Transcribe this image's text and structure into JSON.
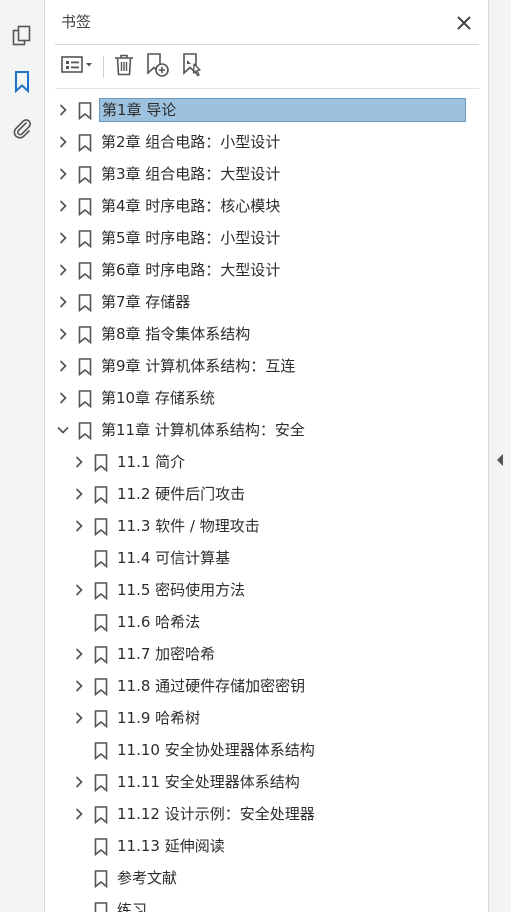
{
  "panel": {
    "title": "书签",
    "close_icon": "close-icon"
  },
  "rail": {
    "items": [
      {
        "name": "page-thumbnails-icon"
      },
      {
        "name": "bookmarks-icon",
        "active": true
      },
      {
        "name": "attachments-icon"
      }
    ]
  },
  "toolbar": {
    "options": "options-menu-icon",
    "delete": "delete-icon",
    "new_bookmark": "new-bookmark-icon",
    "new_from_structure": "new-bookmark-from-structure-icon"
  },
  "colors": {
    "selection_fill": "#9dc2df",
    "selection_border": "#6a9cc4",
    "active_icon": "#1a73c8"
  },
  "bookmarks": [
    {
      "label": "第1章 导论",
      "level": 0,
      "expander": "collapsed",
      "selected": true
    },
    {
      "label": "第2章 组合电路：小型设计",
      "level": 0,
      "expander": "collapsed"
    },
    {
      "label": "第3章 组合电路：大型设计",
      "level": 0,
      "expander": "collapsed"
    },
    {
      "label": "第4章 时序电路：核心模块",
      "level": 0,
      "expander": "collapsed"
    },
    {
      "label": "第5章 时序电路：小型设计",
      "level": 0,
      "expander": "collapsed"
    },
    {
      "label": "第6章 时序电路：大型设计",
      "level": 0,
      "expander": "collapsed"
    },
    {
      "label": "第7章 存储器",
      "level": 0,
      "expander": "collapsed"
    },
    {
      "label": "第8章 指令集体系结构",
      "level": 0,
      "expander": "collapsed"
    },
    {
      "label": "第9章 计算机体系结构：互连",
      "level": 0,
      "expander": "collapsed"
    },
    {
      "label": "第10章 存储系统",
      "level": 0,
      "expander": "collapsed"
    },
    {
      "label": "第11章 计算机体系结构：安全",
      "level": 0,
      "expander": "expanded"
    },
    {
      "label": "11.1 简介",
      "level": 1,
      "expander": "collapsed"
    },
    {
      "label": "11.2 硬件后门攻击",
      "level": 1,
      "expander": "collapsed"
    },
    {
      "label": "11.3 软件 / 物理攻击",
      "level": 1,
      "expander": "collapsed"
    },
    {
      "label": "11.4 可信计算基",
      "level": 1,
      "expander": "none"
    },
    {
      "label": "11.5 密码使用方法",
      "level": 1,
      "expander": "collapsed"
    },
    {
      "label": "11.6 哈希法",
      "level": 1,
      "expander": "none"
    },
    {
      "label": "11.7 加密哈希",
      "level": 1,
      "expander": "collapsed"
    },
    {
      "label": "11.8 通过硬件存储加密密钥",
      "level": 1,
      "expander": "collapsed"
    },
    {
      "label": "11.9 哈希树",
      "level": 1,
      "expander": "collapsed"
    },
    {
      "label": "11.10 安全协处理器体系结构",
      "level": 1,
      "expander": "none"
    },
    {
      "label": "11.11 安全处理器体系结构",
      "level": 1,
      "expander": "collapsed"
    },
    {
      "label": "11.12 设计示例：安全处理器",
      "level": 1,
      "expander": "collapsed"
    },
    {
      "label": "11.13 延伸阅读",
      "level": 1,
      "expander": "none"
    },
    {
      "label": "参考文献",
      "level": 1,
      "expander": "none"
    },
    {
      "label": "练习",
      "level": 1,
      "expander": "none"
    }
  ]
}
